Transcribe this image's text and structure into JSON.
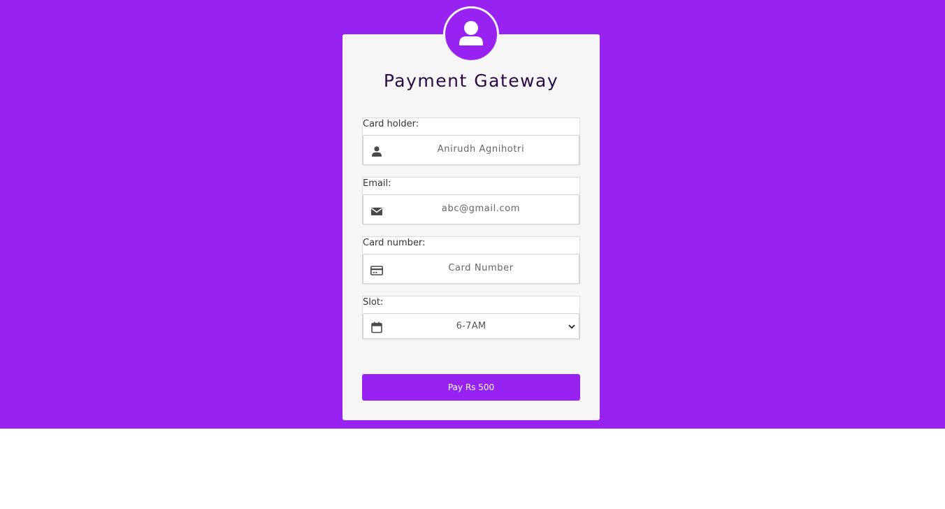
{
  "header": {
    "title": "Payment Gateway",
    "avatar_icon": "user-icon"
  },
  "colors": {
    "accent": "#9822f2",
    "card_bg": "#f6f6f6",
    "title_color": "#2b0a45"
  },
  "form": {
    "card_holder": {
      "label": "Card holder:",
      "value": "Anirudh  Agnihotri",
      "icon": "user-icon"
    },
    "email": {
      "label": "Email:",
      "value": "abc@gmail.com",
      "icon": "envelope-icon"
    },
    "card_number": {
      "label": "Card number:",
      "placeholder": "Card  Number",
      "icon": "credit-card-icon"
    },
    "slot": {
      "label": "Slot:",
      "selected": "6-7AM",
      "icon": "calendar-icon"
    }
  },
  "submit": {
    "label": "Pay Rs 500"
  }
}
